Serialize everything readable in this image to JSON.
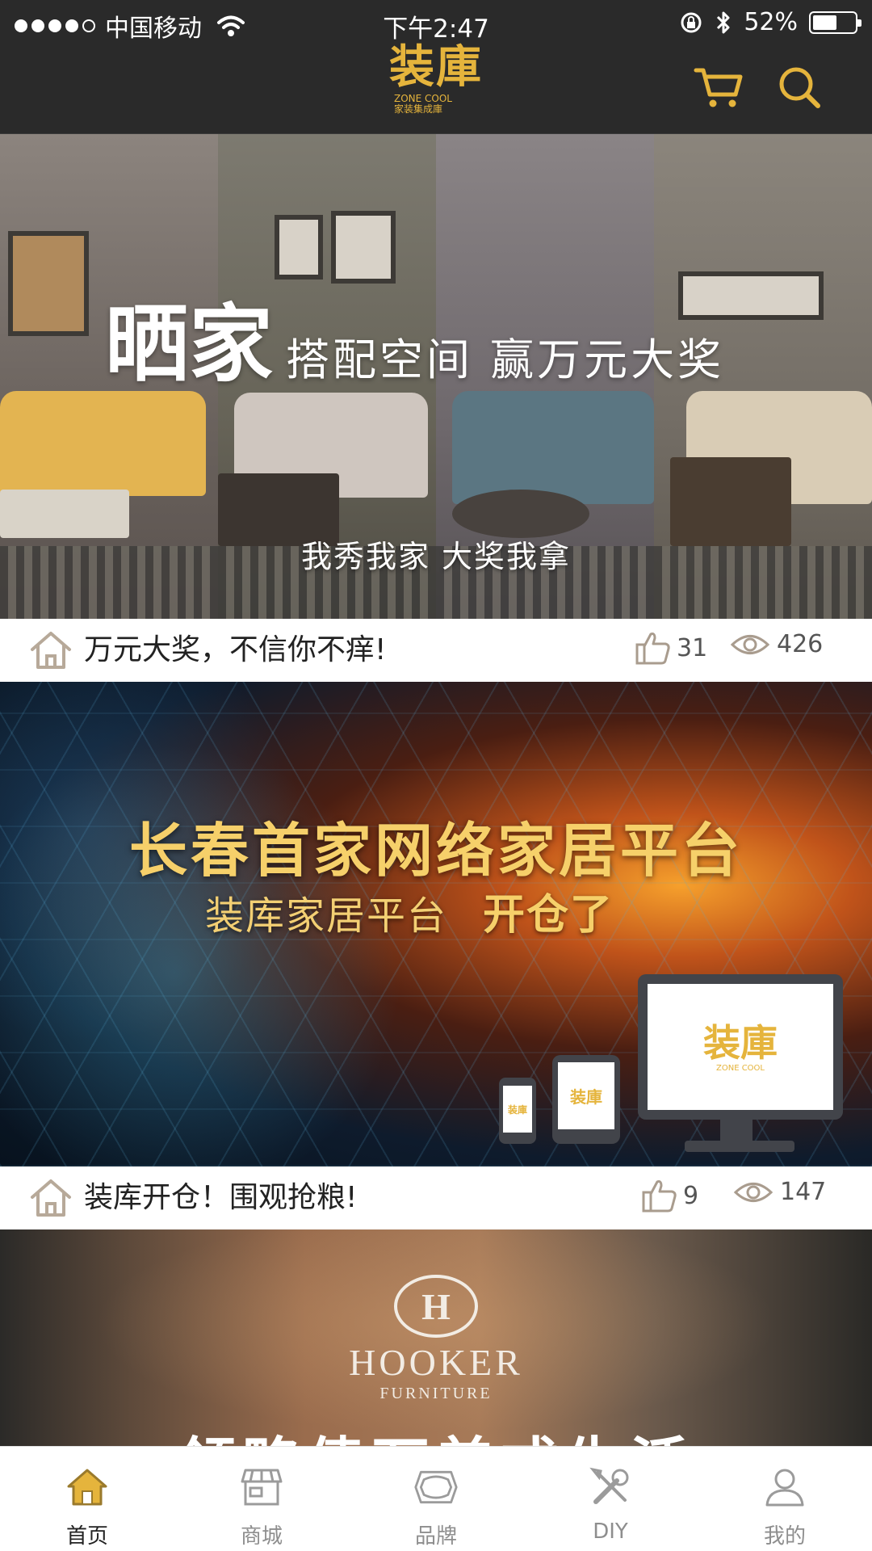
{
  "status_bar": {
    "carrier": "中国移动",
    "time": "下午2:47",
    "battery": "52%",
    "battery_level": 0.52
  },
  "header": {
    "logo_main": "装庫",
    "logo_en": "ZONE COOL",
    "logo_cn": "家装集成庫",
    "icons": [
      "cart-icon",
      "search-icon"
    ],
    "accent_color": "#e5b43c",
    "bar_color": "#2a2a2a"
  },
  "feed": [
    {
      "banner": {
        "title_big": "晒家",
        "title_small": "搭配空间 赢万元大奖",
        "subtitle": "我秀我家 大奖我拿"
      },
      "title": "万元大奖，不信你不痒!",
      "likes": "31",
      "views": "426"
    },
    {
      "banner": {
        "title": "长春首家网络家居平台",
        "subtitle": "装库家居平台",
        "subtitle_highlight": "开仓了",
        "device_logo": "装庫",
        "device_logo_sub": "ZONE COOL"
      },
      "title": "装库开仓！围观抢粮!",
      "likes": "9",
      "views": "147"
    },
    {
      "banner": {
        "brand_mark": "H",
        "brand_name": "HOOKER",
        "brand_sub": "FURNITURE",
        "tagline": "领略债万美式生活"
      }
    }
  ],
  "tabbar": {
    "active_color": "#e5b43c",
    "items": [
      {
        "label": "首页",
        "icon": "home-icon",
        "active": true
      },
      {
        "label": "商城",
        "icon": "store-icon",
        "active": false
      },
      {
        "label": "品牌",
        "icon": "brand-icon",
        "active": false
      },
      {
        "label": "DIY",
        "icon": "tools-icon",
        "active": false
      },
      {
        "label": "我的",
        "icon": "user-icon",
        "active": false
      }
    ]
  }
}
